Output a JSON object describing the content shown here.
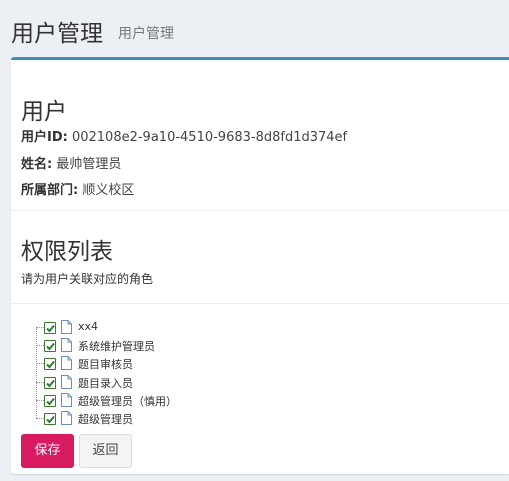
{
  "header": {
    "title": "用户管理",
    "subtitle": "用户管理"
  },
  "user": {
    "heading": "用户",
    "id_label": "用户ID:",
    "id_value": "002108e2-9a10-4510-9683-8d8fd1d374ef",
    "name_label": "姓名:",
    "name_value": "最帅管理员",
    "dept_label": "所属部门:",
    "dept_value": "顺义校区"
  },
  "permissions": {
    "heading": "权限列表",
    "hint": "请为用户关联对应的角色",
    "roles": [
      {
        "label": "xx4",
        "checked": true
      },
      {
        "label": "系统维护管理员",
        "checked": true
      },
      {
        "label": "题目审核员",
        "checked": true
      },
      {
        "label": "题目录入员",
        "checked": true
      },
      {
        "label": "超级管理员（慎用）",
        "checked": true
      },
      {
        "label": "超级管理员",
        "checked": true
      }
    ]
  },
  "actions": {
    "save_label": "保存",
    "back_label": "返回"
  },
  "colors": {
    "accent": "#3c8dbc",
    "save": "#d81b60",
    "check": "#2e7d32"
  },
  "icons": {
    "checkbox": "checkbox-checked-icon",
    "node": "document-icon"
  }
}
